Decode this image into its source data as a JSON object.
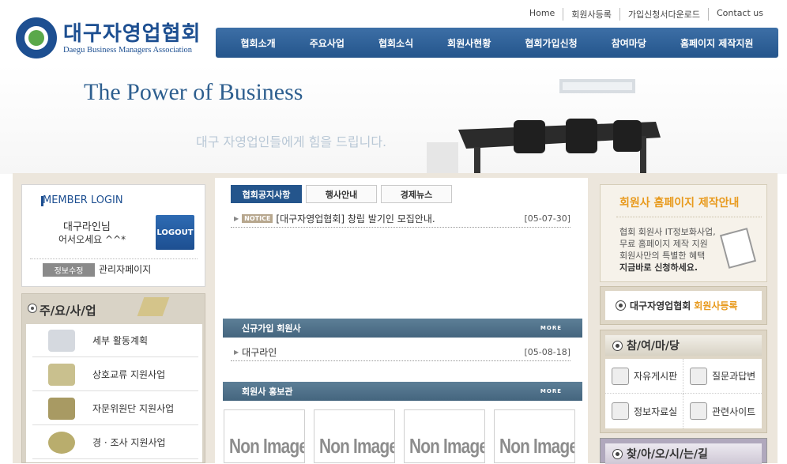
{
  "header": {
    "logo_ko": "대구자영업협회",
    "logo_en": "Daegu Business Managers Association",
    "top_links": [
      "Home",
      "회원사등록",
      "가입신청서다운로드",
      "Contact us"
    ],
    "gnb": [
      "협회소개",
      "주요사업",
      "협회소식",
      "회원사현황",
      "협회가입신청",
      "참여마당",
      "홈페이지 제작지원"
    ]
  },
  "hero": {
    "slogan": "The Power of  Business",
    "tagline": "대구 자영업인들에게 힘을 드립니다."
  },
  "login": {
    "title": "MEMBER LOGIN",
    "user_line1": "대구라인님",
    "user_line2": "어서오세요 ^^*",
    "logout_label": "LOGOUT",
    "info_edit_label": "정보수정",
    "admin_label": "관리자페이지"
  },
  "business": {
    "title": "주/요/사/업",
    "items": [
      {
        "label": "세부 활동계획"
      },
      {
        "label": "상호교류 지원사업"
      },
      {
        "label": "자문위원단 지원사업"
      },
      {
        "label": "경 · 조사 지원사업"
      }
    ]
  },
  "tabs": [
    "협회공지사항",
    "행사안내",
    "경제뉴스"
  ],
  "notice": {
    "tag": "NOTICE",
    "text": "[대구자영업협회] 창립 발기인 모집안내.",
    "date": "[05-07-30]"
  },
  "new_members": {
    "title": "신규가입 회원사",
    "more": "MORE",
    "item": "대구라인",
    "date": "[05-08-18]"
  },
  "promo": {
    "title": "회원사 홍보관",
    "more": "MORE",
    "thumbs": [
      "Non Image",
      "Non Image",
      "Non Image",
      "Non Image"
    ]
  },
  "hp_guide": {
    "title": "회원사 홈페이지 제작안내",
    "lines": [
      "협회 회원사 IT정보화사업,",
      "무료 홈페이지 제작 지원",
      "회원사만의 특별한 혜택",
      "지금바로 신청하세요."
    ]
  },
  "register": {
    "prefix": "대구자영업협회",
    "highlight": "회원사등록"
  },
  "participation": {
    "title": "참/여/마/당",
    "items": [
      "자유게시판",
      "질문과답변",
      "정보자료실",
      "관련사이트"
    ]
  },
  "find": {
    "title": "찾/아/오/시/는/길"
  },
  "colors": {
    "brand": "#1d4f91",
    "accent": "#e89a1d",
    "section_bar": "#4f718a"
  }
}
